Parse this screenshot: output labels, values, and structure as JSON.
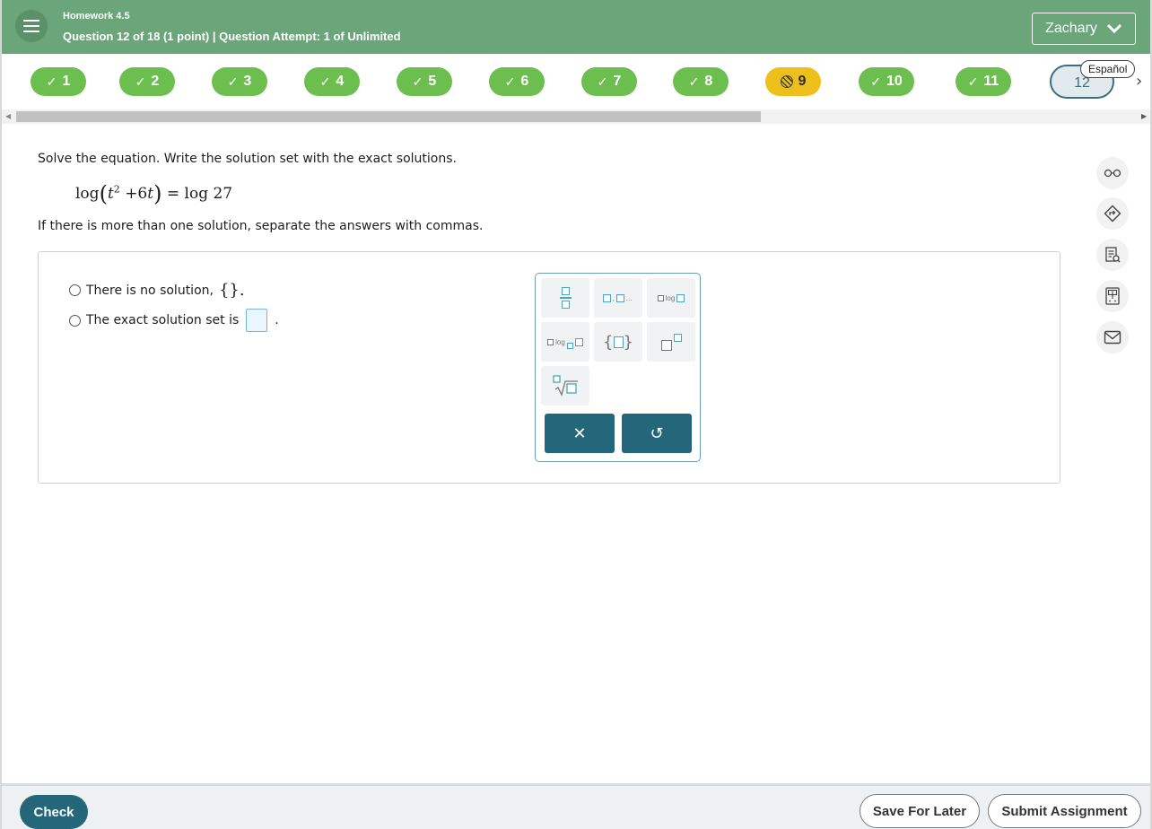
{
  "header": {
    "homework_title": "Homework 4.5",
    "question_info": "Question 12 of 18 (1 point)  |  Question Attempt: 1 of Unlimited",
    "user_name": "Zachary"
  },
  "nav": {
    "questions": [
      {
        "number": "1",
        "status": "correct",
        "check": "✓"
      },
      {
        "number": "2",
        "status": "correct",
        "check": "✓"
      },
      {
        "number": "3",
        "status": "correct",
        "check": "✓"
      },
      {
        "number": "4",
        "status": "correct",
        "check": "✓"
      },
      {
        "number": "5",
        "status": "correct",
        "check": "✓"
      },
      {
        "number": "6",
        "status": "correct",
        "check": "✓"
      },
      {
        "number": "7",
        "status": "correct",
        "check": "✓"
      },
      {
        "number": "8",
        "status": "correct",
        "check": "✓"
      },
      {
        "number": "9",
        "status": "partial"
      },
      {
        "number": "10",
        "status": "correct",
        "check": "✓"
      },
      {
        "number": "11",
        "status": "correct",
        "check": "✓"
      },
      {
        "number": "12",
        "status": "current"
      }
    ],
    "language_label": "Español",
    "next_arrow": "›"
  },
  "question": {
    "prompt": "Solve the equation. Write the solution set with the exact solutions.",
    "equation": {
      "lhs_fn": "log",
      "var": "t",
      "exp": "2",
      "plus": "+6",
      "rhs": "= log 27"
    },
    "instruction": "If there is more than one solution, separate the answers with commas.",
    "options": {
      "no_solution": "There is no solution,",
      "empty_set": "{}.",
      "solution_set": "The exact solution set is",
      "period": "."
    }
  },
  "palette": {
    "log_label": "log",
    "list_suffix": "...",
    "clear": "✕",
    "undo": "↺"
  },
  "footer": {
    "check": "Check",
    "save": "Save For Later",
    "submit": "Submit Assignment"
  },
  "colors": {
    "header_green": "#6ba57a",
    "correct_green": "#6cbf4f",
    "partial_yellow": "#edc01c",
    "primary_teal": "#24667a"
  }
}
